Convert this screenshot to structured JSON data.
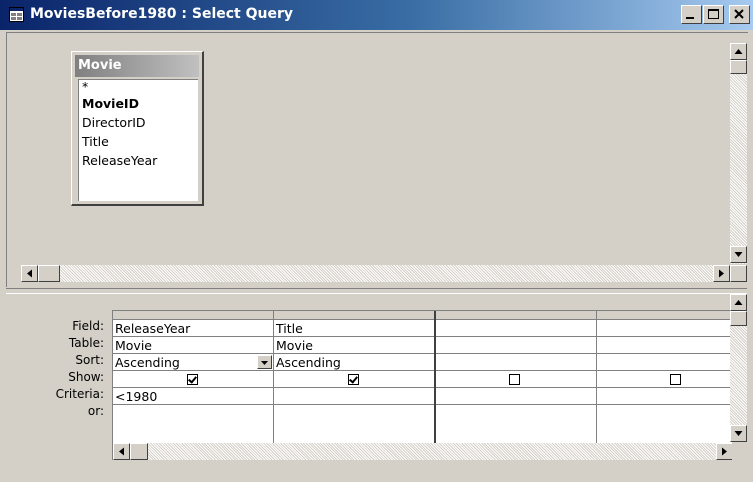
{
  "window": {
    "title": "MoviesBefore1980 : Select Query",
    "minimize_label": "_",
    "maximize_label": "□",
    "close_label": "×"
  },
  "field_list": {
    "table_name": "Movie",
    "fields": [
      {
        "label": "*",
        "primary_key": false
      },
      {
        "label": "MovieID",
        "primary_key": true
      },
      {
        "label": "DirectorID",
        "primary_key": false
      },
      {
        "label": "Title",
        "primary_key": false
      },
      {
        "label": "ReleaseYear",
        "primary_key": false
      }
    ]
  },
  "grid": {
    "row_labels": {
      "field": "Field:",
      "table": "Table:",
      "sort": "Sort:",
      "show": "Show:",
      "criteria": "Criteria:",
      "or": "or:"
    },
    "columns": [
      {
        "field": "ReleaseYear",
        "table": "Movie",
        "sort": "Ascending",
        "show": true,
        "criteria": "<1980",
        "or": ""
      },
      {
        "field": "Title",
        "table": "Movie",
        "sort": "Ascending",
        "show": true,
        "criteria": "",
        "or": ""
      },
      {
        "field": "",
        "table": "",
        "sort": "",
        "show": false,
        "criteria": "",
        "or": ""
      },
      {
        "field": "",
        "table": "",
        "sort": "",
        "show": false,
        "criteria": "",
        "or": ""
      }
    ]
  },
  "colors": {
    "titlebar_start": "#0a246a",
    "titlebar_end": "#a6caf0",
    "face": "#d4d0c8"
  }
}
